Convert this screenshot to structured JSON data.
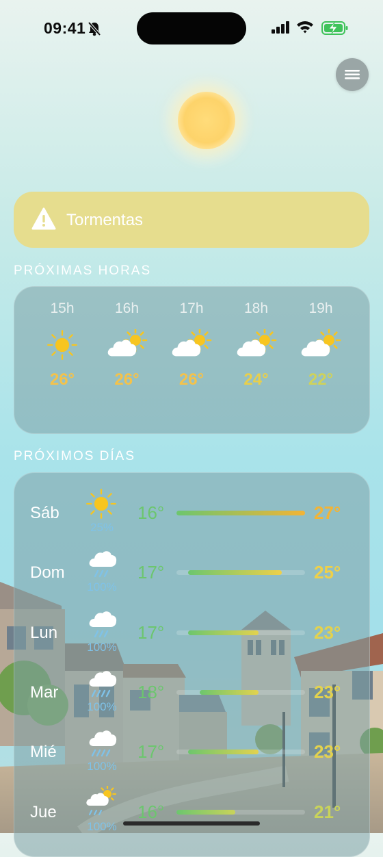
{
  "status_bar": {
    "time": "09:41"
  },
  "alert": {
    "label": "Tormentas"
  },
  "hourly": {
    "title": "PRÓXIMAS HORAS",
    "items": [
      {
        "hour": "15h",
        "icon": "sun-icon",
        "temp": "26°",
        "color": "#f4c24a"
      },
      {
        "hour": "16h",
        "icon": "partly-cloudy-icon",
        "temp": "26°",
        "color": "#f4c24a"
      },
      {
        "hour": "17h",
        "icon": "partly-cloudy-icon",
        "temp": "26°",
        "color": "#f4c24a"
      },
      {
        "hour": "18h",
        "icon": "partly-cloudy-icon",
        "temp": "24°",
        "color": "#e8cf4c"
      },
      {
        "hour": "19h",
        "icon": "partly-cloudy-icon",
        "temp": "22°",
        "color": "#cfd25a"
      }
    ]
  },
  "daily": {
    "title": "PRÓXIMOS DÍAS",
    "items": [
      {
        "day": "Sáb",
        "icon": "sun-icon",
        "precip": "25%",
        "low": "16°",
        "high": "27°",
        "high_color": "#f2b436",
        "range": [
          0.0,
          1.0
        ]
      },
      {
        "day": "Dom",
        "icon": "rain-cloud-icon",
        "precip": "100%",
        "low": "17°",
        "high": "25°",
        "high_color": "#eed04a",
        "range": [
          0.09,
          0.82
        ]
      },
      {
        "day": "Lun",
        "icon": "rain-cloud-icon",
        "precip": "100%",
        "low": "17°",
        "high": "23°",
        "high_color": "#e3d24e",
        "range": [
          0.09,
          0.64
        ]
      },
      {
        "day": "Mar",
        "icon": "heavy-rain-cloud-icon",
        "precip": "100%",
        "low": "18°",
        "high": "23°",
        "high_color": "#e3d24e",
        "range": [
          0.18,
          0.64
        ]
      },
      {
        "day": "Mié",
        "icon": "heavy-rain-cloud-icon",
        "precip": "100%",
        "low": "17°",
        "high": "23°",
        "high_color": "#e3d24e",
        "range": [
          0.09,
          0.64
        ]
      },
      {
        "day": "Jue",
        "icon": "sun-rain-icon",
        "precip": "100%",
        "low": "16°",
        "high": "21°",
        "high_color": "#c9d35a",
        "range": [
          0.0,
          0.46
        ]
      }
    ]
  }
}
